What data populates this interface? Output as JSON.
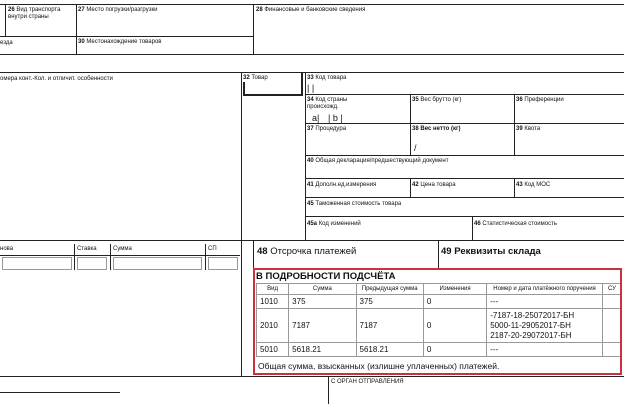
{
  "fields": {
    "f26": {
      "num": "26",
      "label": "Вид транспорта",
      "label2": "внутри страны"
    },
    "f27": {
      "num": "27",
      "label": "Место погрузки/разгрузки"
    },
    "f28": {
      "num": "28",
      "label": "Финансовые и банковские сведения"
    },
    "f29": {
      "label": "езда"
    },
    "f30": {
      "num": "30",
      "label": "Местонахождение товаров"
    },
    "f31": {
      "label": "омера конт.-Кол. и отличит. особенности"
    },
    "f32": {
      "num": "32",
      "label": "Товар"
    },
    "f33": {
      "num": "33",
      "label": "Код товара",
      "value": "| |"
    },
    "f34": {
      "num": "34",
      "label": "Код страны",
      "label2": "происхожд.",
      "sub_a": "a|",
      "sub_b": "| b |"
    },
    "f35": {
      "num": "35",
      "label": "Вес брутто (кг)"
    },
    "f36": {
      "num": "36",
      "label": "Преференции"
    },
    "f37": {
      "num": "37",
      "label": "Процедура"
    },
    "f38": {
      "num": "38",
      "label": "Вес нетто (кг)",
      "value": "/"
    },
    "f39": {
      "num": "39",
      "label": "Квота"
    },
    "f40": {
      "num": "40",
      "label": "Общая декларация/предшествующий документ"
    },
    "f41": {
      "num": "41",
      "label": "Дополн.ед.измерения"
    },
    "f42": {
      "num": "42",
      "label": "Цена товара"
    },
    "f43": {
      "num": "43",
      "label": "Код МОС"
    },
    "f45": {
      "num": "45",
      "label": "Таможенная стоимость товара"
    },
    "f45a": {
      "num": "45а",
      "label": "Код изменений"
    },
    "f46": {
      "num": "46",
      "label": "Статистическая стоимость"
    },
    "f48": {
      "num": "48",
      "label": "Отсрочка платежей"
    },
    "f49": {
      "num": "49",
      "label": "Реквизиты склада"
    }
  },
  "left_table": {
    "headers": [
      "нова",
      "Ставка",
      "Сумма",
      "СП"
    ]
  },
  "calc": {
    "title": "В ПОДРОБНОСТИ ПОДСЧЁТА",
    "headers": [
      "Вид",
      "Сумма",
      "Предыдущая сумма",
      "Изменения",
      "Номер и дата платёжного поручения",
      "СУ"
    ],
    "rows": [
      {
        "type": "1010",
        "sum": "375",
        "prev": "375",
        "change": "0",
        "orders": [
          "---"
        ]
      },
      {
        "type": "2010",
        "sum": "7187",
        "prev": "7187",
        "change": "0",
        "orders": [
          "-7187-18-25072017-БН",
          "5000-11-29052017-БН",
          "2187-20-29072017-БН"
        ]
      },
      {
        "type": "5010",
        "sum": "5618.21",
        "prev": "5618.21",
        "change": "0",
        "orders": [
          "---"
        ]
      }
    ],
    "total": "Общая сумма, взысканных (излишне уплаченных) платежей."
  },
  "bottom": {
    "c_label": "С ОРГАН ОТПРАВЛЕНИЯ"
  }
}
